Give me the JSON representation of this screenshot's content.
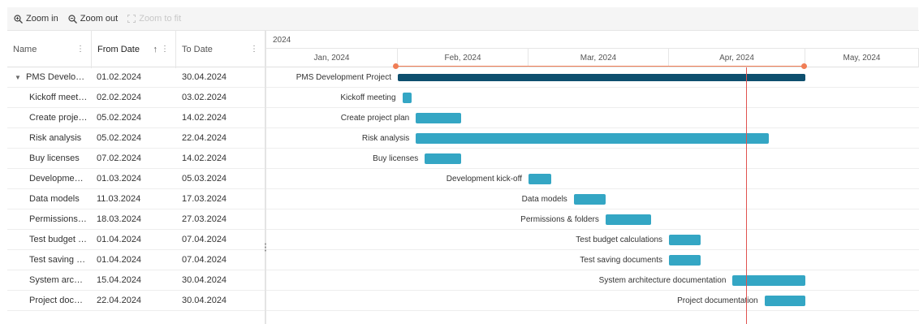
{
  "toolbar": {
    "zoom_in_label": "Zoom in",
    "zoom_out_label": "Zoom out",
    "zoom_fit_label": "Zoom to fit"
  },
  "grid": {
    "columns": [
      {
        "label": "Name",
        "sorted": false
      },
      {
        "label": "From Date",
        "sorted": true,
        "sort_direction": "ascending"
      },
      {
        "label": "To Date",
        "sorted": false
      }
    ]
  },
  "timeline": {
    "year": "2024",
    "months": [
      "Jan, 2024",
      "Feb, 2024",
      "Mar, 2024",
      "Apr, 2024",
      "May, 2024"
    ]
  },
  "tasks": [
    {
      "name": "PMS Develop…",
      "full_name": "PMS Development Project",
      "from": "01.02.2024",
      "to": "30.04.2024",
      "summary": true,
      "expanded": true
    },
    {
      "name": "Kickoff meeting",
      "full_name": "Kickoff meeting",
      "from": "02.02.2024",
      "to": "03.02.2024"
    },
    {
      "name": "Create projec…",
      "full_name": "Create project plan",
      "from": "05.02.2024",
      "to": "14.02.2024"
    },
    {
      "name": "Risk analysis",
      "full_name": "Risk analysis",
      "from": "05.02.2024",
      "to": "22.04.2024"
    },
    {
      "name": "Buy licenses",
      "full_name": "Buy licenses",
      "from": "07.02.2024",
      "to": "14.02.2024"
    },
    {
      "name": "Development…",
      "full_name": "Development kick-off",
      "from": "01.03.2024",
      "to": "05.03.2024"
    },
    {
      "name": "Data models",
      "full_name": "Data models",
      "from": "11.03.2024",
      "to": "17.03.2024"
    },
    {
      "name": "Permissions …",
      "full_name": "Permissions & folders",
      "from": "18.03.2024",
      "to": "27.03.2024"
    },
    {
      "name": "Test budget c…",
      "full_name": "Test budget calculations",
      "from": "01.04.2024",
      "to": "07.04.2024"
    },
    {
      "name": "Test saving d…",
      "full_name": "Test saving documents",
      "from": "01.04.2024",
      "to": "07.04.2024"
    },
    {
      "name": "System archit…",
      "full_name": "System architecture documentation",
      "from": "15.04.2024",
      "to": "30.04.2024"
    },
    {
      "name": "Project docu…",
      "full_name": "Project documentation",
      "from": "22.04.2024",
      "to": "30.04.2024"
    }
  ],
  "today": "18.04.2024",
  "colors": {
    "task_bar": "#34a6c4",
    "summary_bar": "#0e4f6e",
    "today_line": "#e0534f",
    "range_marker": "#f07d55",
    "toolbar_bg": "#f5f5f5"
  },
  "icons": {
    "zoom_in": "zoom-in-icon",
    "zoom_out": "zoom-out-icon",
    "zoom_fit": "zoom-fit-icon",
    "column_menu": "kebab-menu-icon",
    "sort": "sort-ascending-icon",
    "expander": "caret-down-icon"
  }
}
